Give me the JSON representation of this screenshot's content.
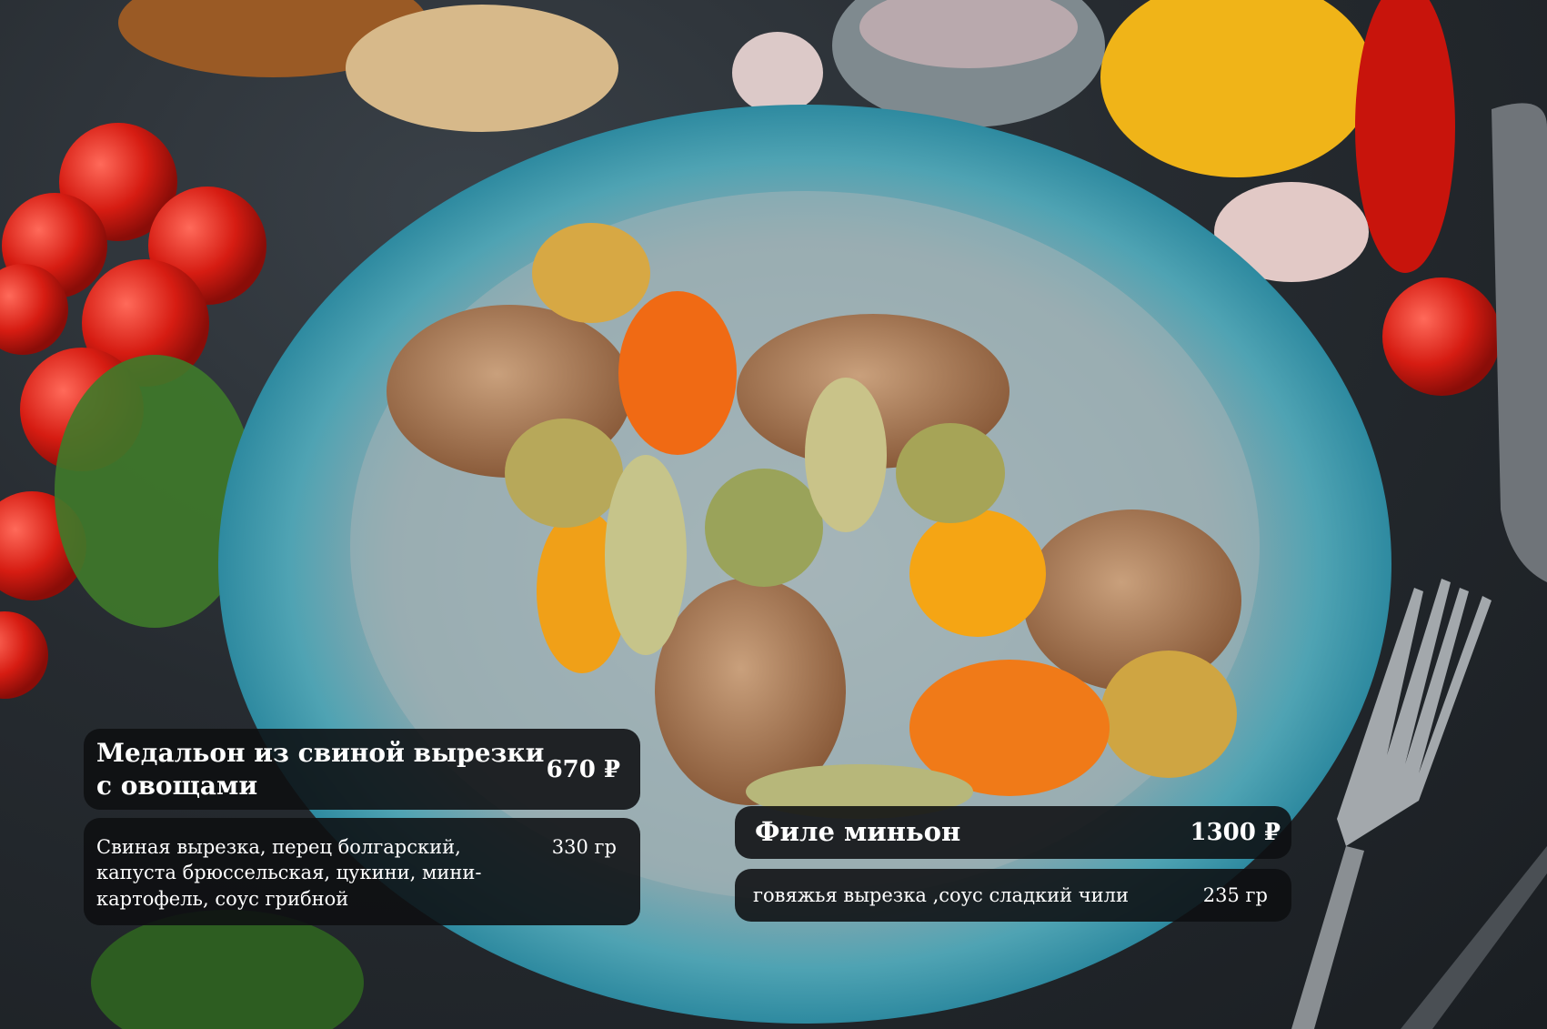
{
  "menu": {
    "dishes": [
      {
        "title_line1": "Медальон из свиной вырезки",
        "title_line2": "с овощами",
        "price": "670 ₽",
        "description": "Свиная вырезка, перец болгарский, капуста брюссельская, цукини, мини-картофель, соус грибной",
        "weight": "330 гр"
      },
      {
        "title": "Филе миньон",
        "price": "1300 ₽",
        "description": "говяжья вырезка ,соус сладкий чили",
        "weight": "235 гр"
      }
    ]
  },
  "colors": {
    "card_background": "#0e0f11",
    "card_text": "#ffffff",
    "plate": "#7fa9b3",
    "table": "#262b30"
  }
}
